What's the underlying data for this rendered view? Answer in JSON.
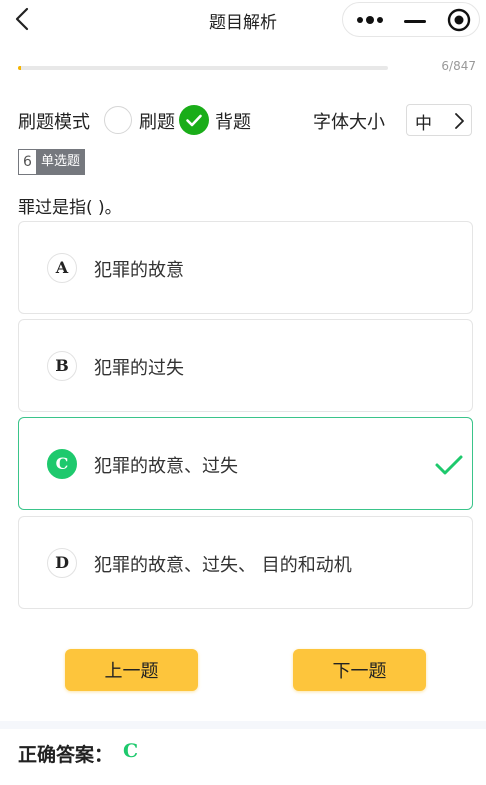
{
  "header": {
    "title": "题目解析"
  },
  "progress": {
    "current": 6,
    "total": 847,
    "label": "6/847",
    "fraction": 0.0071
  },
  "mode": {
    "label": "刷题模式",
    "options": [
      {
        "label": "刷题",
        "selected": false
      },
      {
        "label": "背题",
        "selected": true
      }
    ]
  },
  "font_size": {
    "label": "字体大小",
    "value": "中"
  },
  "question": {
    "number": "6",
    "type": "单选题",
    "text": "罪过是指( )。",
    "options": [
      {
        "letter": "A",
        "text": "犯罪的故意",
        "correct": false
      },
      {
        "letter": "B",
        "text": "犯罪的过失",
        "correct": false
      },
      {
        "letter": "C",
        "text": "犯罪的故意、过失",
        "correct": true
      },
      {
        "letter": "D",
        "text": "犯罪的故意、过失、 目的和动机",
        "correct": false
      }
    ]
  },
  "nav": {
    "prev": "上一题",
    "next": "下一题"
  },
  "answer": {
    "label": "正确答案：",
    "value": "C"
  },
  "colors": {
    "accent_green": "#1ec96d",
    "radio_green": "#1aad19",
    "button_yellow": "#fdc53c",
    "progress": "#f5b400"
  },
  "icons": {
    "back": "chevron-left-icon",
    "more": "more-dots-icon",
    "minimize": "minimize-icon",
    "close": "target-circle-icon",
    "select": "chevron-right-icon",
    "check": "check-icon"
  }
}
